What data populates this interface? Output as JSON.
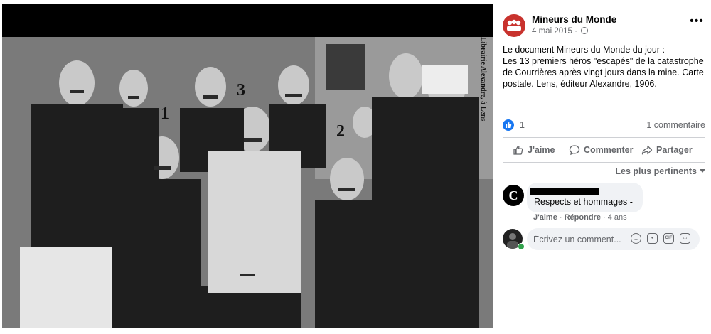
{
  "photo": {
    "alt_label_spine": "Librairie Alexandre, à Lens",
    "numbers": [
      "1",
      "2",
      "3"
    ]
  },
  "post": {
    "page_name": "Mineurs du Monde",
    "date": "4 mai 2015",
    "privacy_icon": "globe-icon",
    "more_icon": "more-options-icon",
    "text": "Le document Mineurs du Monde du jour :\nLes 13 premiers héros \"escapés\" de la catastrophe de Courrières après vingt jours dans la mine. Carte postale. Lens, éditeur Alexandre, 1906.",
    "like_count": "1",
    "comment_count": "1 commentaire"
  },
  "actions": {
    "like": "J'aime",
    "comment": "Commenter",
    "share": "Partager"
  },
  "comments": {
    "sort_label": "Les plus pertinents",
    "items": [
      {
        "avatar_letter": "C",
        "text": "Respects et hommages -",
        "like_label": "J'aime",
        "reply_label": "Répondre",
        "age": "4 ans"
      }
    ],
    "input_placeholder": "Écrivez un comment..."
  },
  "colors": {
    "brand_blue": "#1877f2",
    "avatar_red": "#c8322d",
    "muted_text": "#65676b",
    "bubble_bg": "#f0f2f5",
    "online_green": "#31a24c"
  }
}
